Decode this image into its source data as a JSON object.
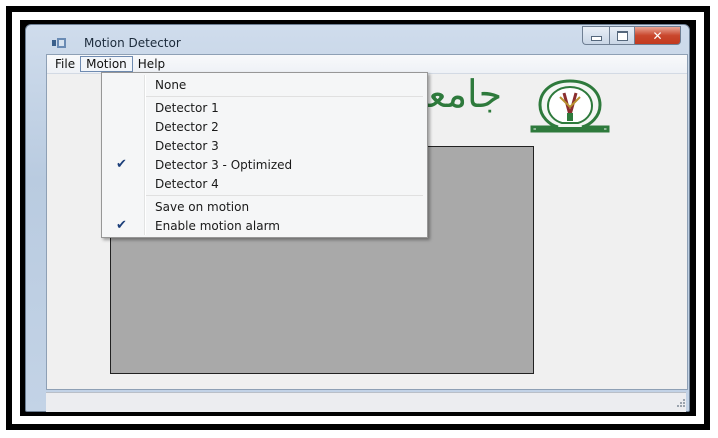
{
  "window": {
    "title": "Motion Detector"
  },
  "menubar": {
    "items": [
      "File",
      "Motion",
      "Help"
    ],
    "active": "Motion"
  },
  "motion_menu": {
    "items": [
      {
        "label": "None",
        "checked": false
      },
      {
        "label": "Detector 1",
        "checked": false
      },
      {
        "label": "Detector 2",
        "checked": false
      },
      {
        "label": "Detector 3",
        "checked": false
      },
      {
        "label": "Detector 3 - Optimized",
        "checked": true
      },
      {
        "label": "Detector 4",
        "checked": false
      },
      {
        "label": "Save on motion",
        "checked": false
      },
      {
        "label": "Enable motion alarm",
        "checked": true
      }
    ],
    "check_glyph": "✔"
  },
  "logo": {
    "text": "جامعة"
  },
  "icons": [
    "app-icon",
    "minimize-icon",
    "maximize-icon",
    "close-icon",
    "university-emblem-icon",
    "resize-grip-icon",
    "checkmark-icon"
  ],
  "colors": {
    "logo_green": "#2e7a3c",
    "video_panel": "#a9a9a9",
    "close_button": "#c9472d"
  }
}
